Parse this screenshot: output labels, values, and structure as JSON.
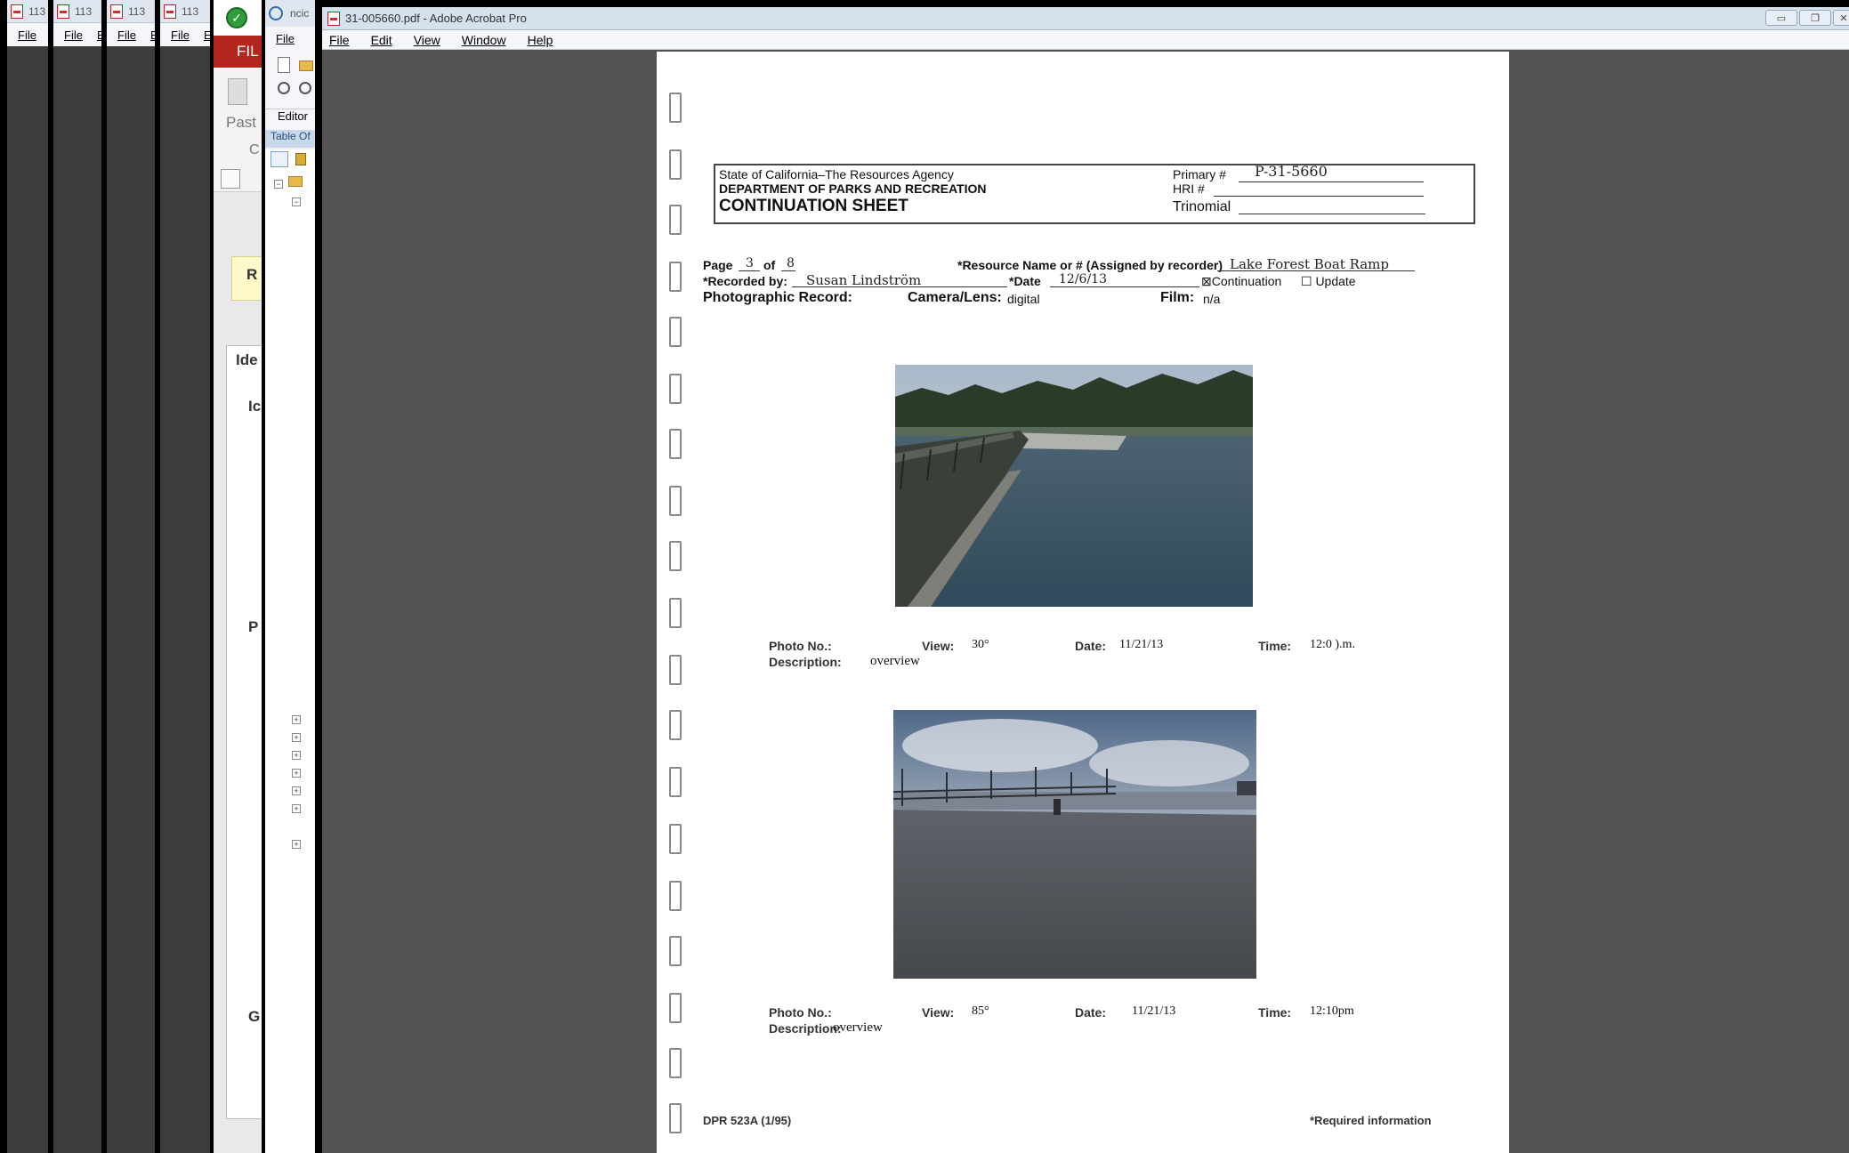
{
  "background_windows": [
    {
      "title": "113",
      "menu": [
        "File",
        "E"
      ]
    },
    {
      "title": "113",
      "menu": [
        "File",
        "E"
      ]
    },
    {
      "title": "113",
      "menu": [
        "File",
        "E"
      ]
    },
    {
      "title": "113",
      "menu": [
        "File",
        "E"
      ]
    }
  ],
  "word_window": {
    "tab": "FIL",
    "paste": "Past",
    "c_label": "C",
    "r_label": "R",
    "ide_label": "Ide",
    "ic_label": "Ic",
    "p_label": "P",
    "g_label": "G"
  },
  "ncic_window": {
    "title": "ncic",
    "menu_file": "File",
    "editor": "Editor",
    "toc": "Table Of"
  },
  "acrobat": {
    "title": "31-005660.pdf - Adobe Acrobat Pro",
    "menu": [
      "File",
      "Edit",
      "View",
      "Window",
      "Help"
    ]
  },
  "document": {
    "agency": "State of California–The Resources Agency",
    "department": "DEPARTMENT OF PARKS AND RECREATION",
    "sheet_title": "CONTINUATION SHEET",
    "primary_label": "Primary #",
    "primary_value": "P-31-5660",
    "hri_label": "HRI #",
    "trinomial_label": "Trinomial",
    "page_label": "Page",
    "page_num": "3",
    "of_label": "of",
    "page_total": "8",
    "resource_label": "*Resource Name or # (Assigned by recorder)",
    "resource_value": "Lake Forest Boat Ramp",
    "recorded_label": "*Recorded by:",
    "recorded_value": "Susan Lindström",
    "date_label": "*Date",
    "date_value": "12/6/13",
    "continuation_label": "⊠Continuation",
    "update_label": "☐ Update",
    "photo_record_label": "Photographic Record:",
    "camera_label": "Camera/Lens:",
    "camera_value": "digital",
    "film_label": "Film:",
    "film_value": "n/a",
    "photos": [
      {
        "photo_no_label": "Photo No.:",
        "view_label": "View:",
        "view_value": "30°",
        "date_label": "Date:",
        "date_value": "11/21/13",
        "time_label": "Time:",
        "time_value": "12:0 ).m.",
        "desc_label": "Description:",
        "desc_value": "overview"
      },
      {
        "photo_no_label": "Photo No.:",
        "view_label": "View:",
        "view_value": "85°",
        "date_label": "Date:",
        "date_value": "11/21/13",
        "time_label": "Time:",
        "time_value": "12:10pm",
        "desc_label": "Description:",
        "desc_value": "overview"
      }
    ],
    "form_number": "DPR 523A (1/95)",
    "required_note": "*Required information"
  }
}
